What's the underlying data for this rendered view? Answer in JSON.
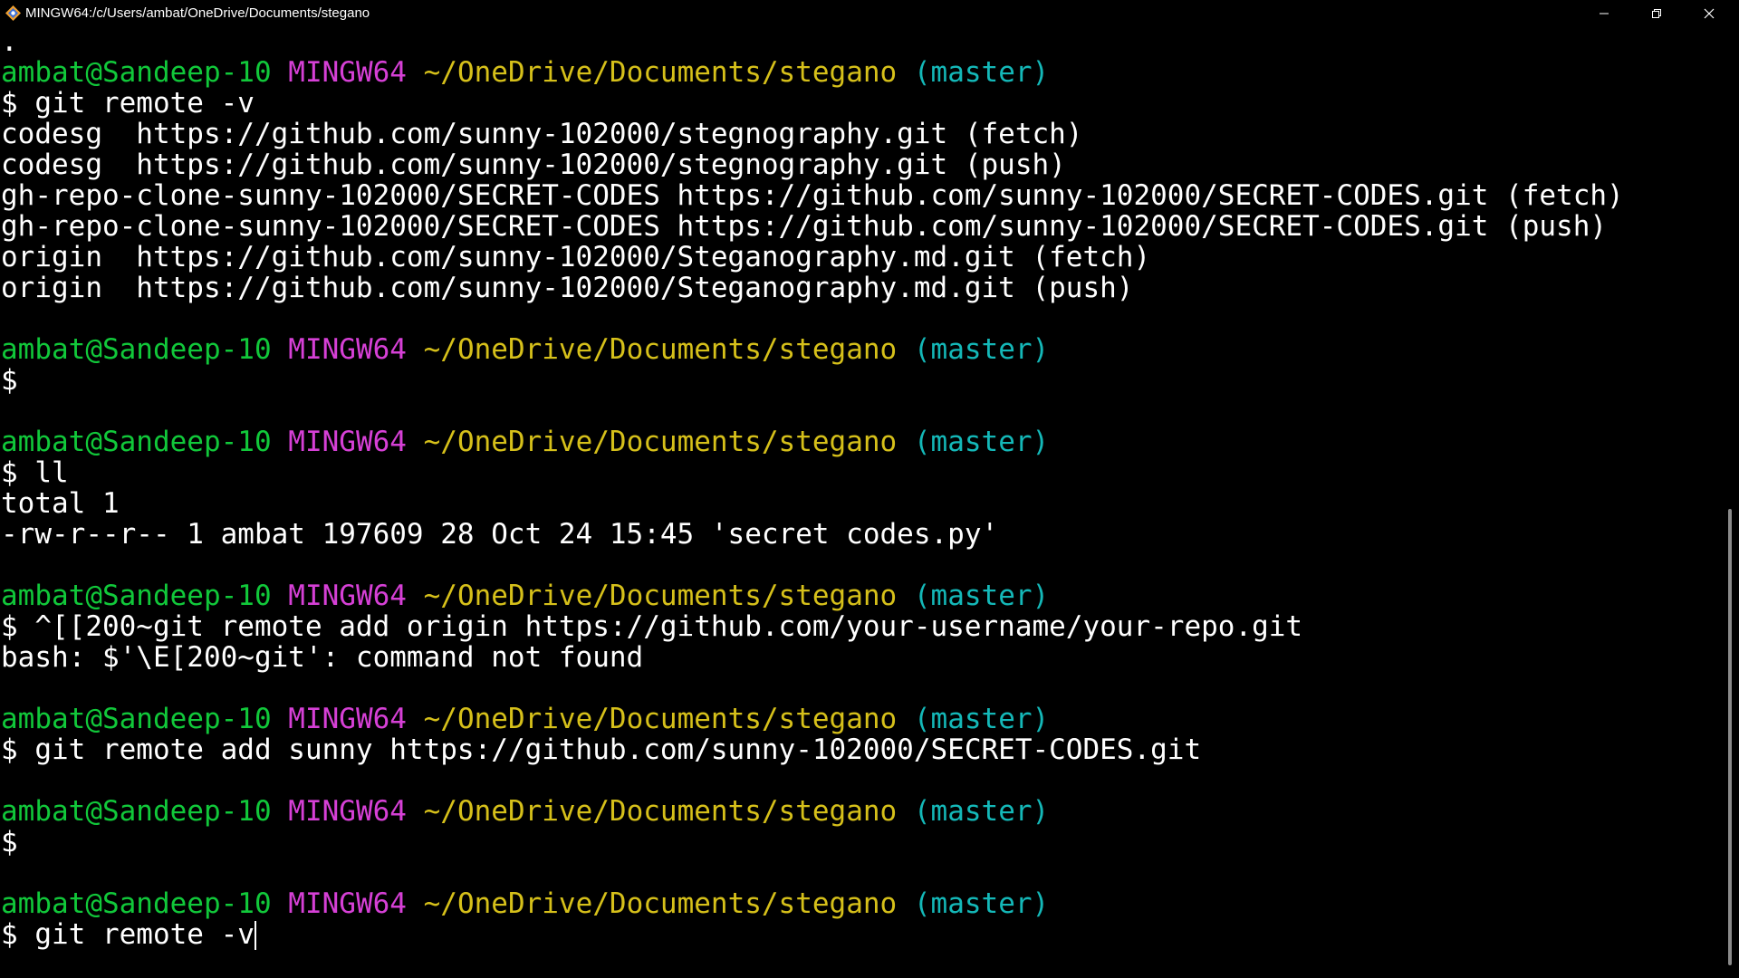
{
  "window": {
    "title": "MINGW64:/c/Users/ambat/OneDrive/Documents/stegano",
    "app_icon": "git-bash-icon",
    "controls": [
      "minimize-icon",
      "restore-icon",
      "close-icon"
    ]
  },
  "colors": {
    "background": "#000000",
    "text": "#ffffff",
    "user_host": "#11c83a",
    "system": "#d640d6",
    "path": "#d6c01a",
    "branch": "#14b8b8"
  },
  "prompt": {
    "user_host": "ambat@Sandeep-10",
    "system": "MINGW64",
    "path": "~/OneDrive/Documents/stegano",
    "branch": "(master)"
  },
  "terminal": {
    "lines": [
      {
        "type": "out",
        "text": "."
      },
      {
        "type": "prompt"
      },
      {
        "type": "out",
        "text": "$ git remote -v"
      },
      {
        "type": "out",
        "text": "codesg  https://github.com/sunny-102000/stegnography.git (fetch)"
      },
      {
        "type": "out",
        "text": "codesg  https://github.com/sunny-102000/stegnography.git (push)"
      },
      {
        "type": "out",
        "text": "gh-repo-clone-sunny-102000/SECRET-CODES https://github.com/sunny-102000/SECRET-CODES.git (fetch)"
      },
      {
        "type": "out",
        "text": "gh-repo-clone-sunny-102000/SECRET-CODES https://github.com/sunny-102000/SECRET-CODES.git (push)"
      },
      {
        "type": "out",
        "text": "origin  https://github.com/sunny-102000/Steganography.md.git (fetch)"
      },
      {
        "type": "out",
        "text": "origin  https://github.com/sunny-102000/Steganography.md.git (push)"
      },
      {
        "type": "out",
        "text": ""
      },
      {
        "type": "prompt"
      },
      {
        "type": "out",
        "text": "$"
      },
      {
        "type": "out",
        "text": ""
      },
      {
        "type": "prompt"
      },
      {
        "type": "out",
        "text": "$ ll"
      },
      {
        "type": "out",
        "text": "total 1"
      },
      {
        "type": "out",
        "text": "-rw-r--r-- 1 ambat 197609 28 Oct 24 15:45 'secret codes.py'"
      },
      {
        "type": "out",
        "text": ""
      },
      {
        "type": "prompt"
      },
      {
        "type": "out",
        "text": "$ ^[[200~git remote add origin https://github.com/your-username/your-repo.git"
      },
      {
        "type": "out",
        "text": "bash: $'\\E[200~git': command not found"
      },
      {
        "type": "out",
        "text": ""
      },
      {
        "type": "prompt"
      },
      {
        "type": "out",
        "text": "$ git remote add sunny https://github.com/sunny-102000/SECRET-CODES.git"
      },
      {
        "type": "out",
        "text": ""
      },
      {
        "type": "prompt"
      },
      {
        "type": "out",
        "text": "$"
      },
      {
        "type": "out",
        "text": ""
      },
      {
        "type": "prompt"
      },
      {
        "type": "out",
        "text": "$ git remote -v",
        "cursor": true
      }
    ]
  }
}
